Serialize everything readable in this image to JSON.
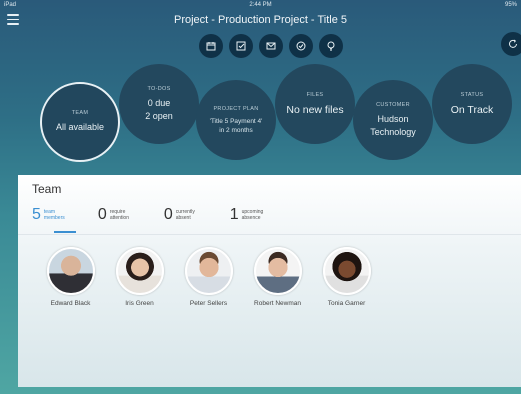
{
  "status_bar": {
    "carrier": "iPad",
    "time": "2:44 PM",
    "battery": "95%"
  },
  "header": {
    "title": "Project - Production Project - Title 5"
  },
  "toolbar": {
    "buttons": [
      {
        "icon": "calendar-icon"
      },
      {
        "icon": "task-icon"
      },
      {
        "icon": "mail-icon"
      },
      {
        "icon": "check-icon"
      },
      {
        "icon": "lightbulb-icon"
      }
    ],
    "refresh_icon": "refresh-icon"
  },
  "summary": {
    "team": {
      "caption": "TEAM",
      "value": "All available"
    },
    "todos": {
      "caption": "TO-DOS",
      "line1": "0 due",
      "line2": "2 open"
    },
    "project_plan": {
      "caption": "PROJECT PLAN",
      "line1": "'Title 5 Payment 4'",
      "line2": "in 2 months"
    },
    "files": {
      "caption": "FILES",
      "value": "No new files"
    },
    "customer": {
      "caption": "CUSTOMER",
      "line1": "Hudson",
      "line2": "Technology"
    },
    "status": {
      "caption": "STATUS",
      "value": "On Track"
    }
  },
  "team_panel": {
    "title": "Team",
    "stats": [
      {
        "count": "5",
        "label": "team members"
      },
      {
        "count": "0",
        "label": "require attention"
      },
      {
        "count": "0",
        "label": "currently absent"
      },
      {
        "count": "1",
        "label": "upcoming absence"
      }
    ],
    "members": [
      {
        "name": "Edward Black"
      },
      {
        "name": "Iris Green"
      },
      {
        "name": "Peter Sellers"
      },
      {
        "name": "Robert Newman"
      },
      {
        "name": "Tonia Garner"
      }
    ]
  },
  "colors": {
    "accent": "#3a8fd1",
    "bubble": "#23485e",
    "toolbar_button": "#0f3147"
  }
}
